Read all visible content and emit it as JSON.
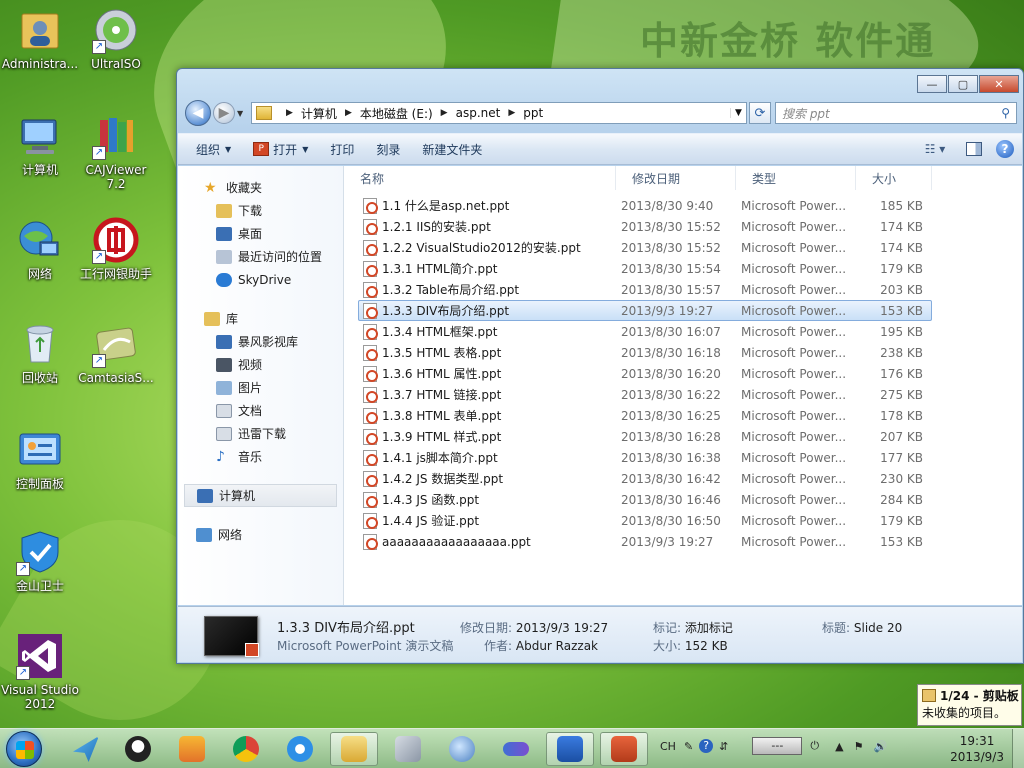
{
  "wallpaper": {
    "brand_text": "中新金桥 软件通"
  },
  "desktop_icons": [
    {
      "label": "Administra..."
    },
    {
      "label": "UltraISO"
    },
    {
      "label": "计算机"
    },
    {
      "label": "CAJViewer 7.2"
    },
    {
      "label": "网络"
    },
    {
      "label": "工行网银助手"
    },
    {
      "label": "回收站"
    },
    {
      "label": "CamtasiaS..."
    },
    {
      "label": "控制面板"
    },
    {
      "label": "金山卫士"
    },
    {
      "label": "Visual Studio 2012"
    }
  ],
  "window": {
    "controls": {
      "minimize": "—",
      "maximize": "▢",
      "close": "✕"
    },
    "address": {
      "segments": [
        "计算机",
        "本地磁盘 (E:)",
        "asp.net",
        "ppt"
      ]
    },
    "search": {
      "placeholder": "搜索 ppt"
    },
    "toolbar": {
      "organize": "组织",
      "open": "打开",
      "print": "打印",
      "burn": "刻录",
      "new_folder": "新建文件夹"
    },
    "nav": {
      "favorites": "收藏夹",
      "favorite_items": [
        "下载",
        "桌面",
        "最近访问的位置",
        "SkyDrive"
      ],
      "libraries": "库",
      "library_items": [
        "暴风影视库",
        "视频",
        "图片",
        "文档",
        "迅雷下载",
        "音乐"
      ],
      "computer": "计算机",
      "network": "网络"
    },
    "columns": {
      "name": "名称",
      "date": "修改日期",
      "type": "类型",
      "size": "大小"
    },
    "files": [
      {
        "name": "1.1  什么是asp.net.ppt",
        "date": "2013/8/30 9:40",
        "type": "Microsoft Power...",
        "size": "185 KB"
      },
      {
        "name": "1.2.1 IIS的安装.ppt",
        "date": "2013/8/30 15:52",
        "type": "Microsoft Power...",
        "size": "174 KB"
      },
      {
        "name": "1.2.2 VisualStudio2012的安装.ppt",
        "date": "2013/8/30 15:52",
        "type": "Microsoft Power...",
        "size": "174 KB"
      },
      {
        "name": "1.3.1 HTML简介.ppt",
        "date": "2013/8/30 15:54",
        "type": "Microsoft Power...",
        "size": "179 KB"
      },
      {
        "name": "1.3.2 Table布局介绍.ppt",
        "date": "2013/8/30 15:57",
        "type": "Microsoft Power...",
        "size": "203 KB"
      },
      {
        "name": "1.3.3 DIV布局介绍.ppt",
        "date": "2013/9/3 19:27",
        "type": "Microsoft Power...",
        "size": "153 KB"
      },
      {
        "name": "1.3.4 HTML框架.ppt",
        "date": "2013/8/30 16:07",
        "type": "Microsoft Power...",
        "size": "195 KB"
      },
      {
        "name": "1.3.5 HTML 表格.ppt",
        "date": "2013/8/30 16:18",
        "type": "Microsoft Power...",
        "size": "238 KB"
      },
      {
        "name": "1.3.6 HTML 属性.ppt",
        "date": "2013/8/30 16:20",
        "type": "Microsoft Power...",
        "size": "176 KB"
      },
      {
        "name": "1.3.7 HTML 链接.ppt",
        "date": "2013/8/30 16:22",
        "type": "Microsoft Power...",
        "size": "275 KB"
      },
      {
        "name": "1.3.8 HTML 表单.ppt",
        "date": "2013/8/30 16:25",
        "type": "Microsoft Power...",
        "size": "178 KB"
      },
      {
        "name": "1.3.9 HTML 样式.ppt",
        "date": "2013/8/30 16:28",
        "type": "Microsoft Power...",
        "size": "207 KB"
      },
      {
        "name": "1.4.1 js脚本简介.ppt",
        "date": "2013/8/30 16:38",
        "type": "Microsoft Power...",
        "size": "177 KB"
      },
      {
        "name": "1.4.2 JS 数据类型.ppt",
        "date": "2013/8/30 16:42",
        "type": "Microsoft Power...",
        "size": "230 KB"
      },
      {
        "name": "1.4.3 JS 函数.ppt",
        "date": "2013/8/30 16:46",
        "type": "Microsoft Power...",
        "size": "284 KB"
      },
      {
        "name": "1.4.4 JS 验证.ppt",
        "date": "2013/8/30 16:50",
        "type": "Microsoft Power...",
        "size": "179 KB"
      },
      {
        "name": "aaaaaaaaaaaaaaaaa.ppt",
        "date": "2013/9/3 19:27",
        "type": "Microsoft Power...",
        "size": "153 KB"
      }
    ],
    "selected_file_index": 5,
    "details": {
      "name": "1.3.3 DIV布局介绍.ppt",
      "kind": "Microsoft PowerPoint 演示文稿",
      "modified_label": "修改日期:",
      "modified_value": "2013/9/3 19:27",
      "author_label": "作者:",
      "author_value": "Abdur Razzak",
      "tags_label": "标记:",
      "tags_value": "添加标记",
      "size_label": "大小:",
      "size_value": "152 KB",
      "title_label": "标题:",
      "title_value": "Slide 20"
    }
  },
  "notification": {
    "count": "1/24 - 剪贴板",
    "text": "未收集的项目。"
  },
  "taskbar": {
    "input_method": "CH",
    "battery_text": "---",
    "time": "19:31",
    "date": "2013/9/3"
  }
}
